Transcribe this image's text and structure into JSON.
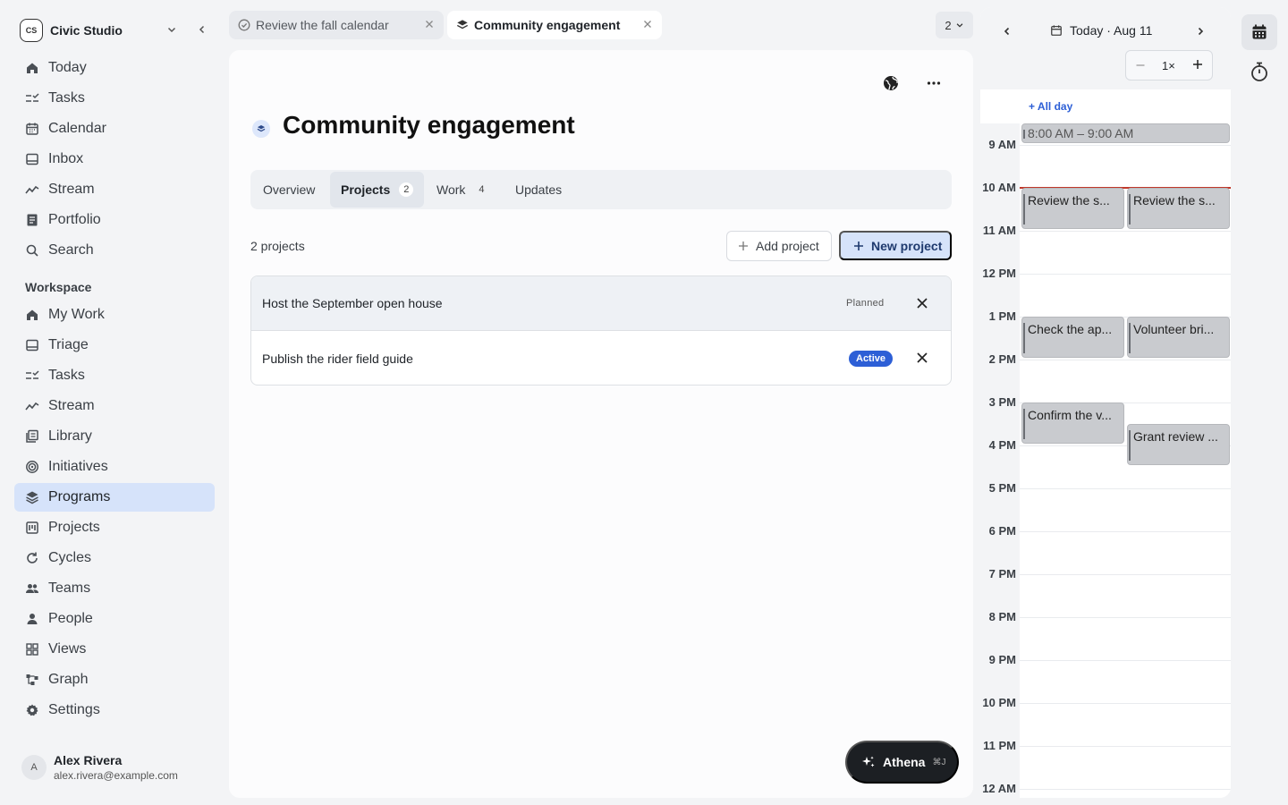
{
  "workspace": {
    "logo": "CS",
    "name": "Civic Studio"
  },
  "nav_main": [
    {
      "label": "Today",
      "icon": "home-icon"
    },
    {
      "label": "Tasks",
      "icon": "tasks-icon"
    },
    {
      "label": "Calendar",
      "icon": "calendar-icon"
    },
    {
      "label": "Inbox",
      "icon": "inbox-icon"
    },
    {
      "label": "Stream",
      "icon": "stream-icon"
    },
    {
      "label": "Portfolio",
      "icon": "portfolio-icon"
    },
    {
      "label": "Search",
      "icon": "search-icon"
    }
  ],
  "workspace_section": {
    "label": "Workspace",
    "items": [
      {
        "label": "My Work",
        "icon": "home-icon"
      },
      {
        "label": "Triage",
        "icon": "inbox-icon"
      },
      {
        "label": "Tasks",
        "icon": "tasks-icon"
      },
      {
        "label": "Stream",
        "icon": "stream-icon"
      },
      {
        "label": "Library",
        "icon": "library-icon"
      },
      {
        "label": "Initiatives",
        "icon": "target-icon"
      },
      {
        "label": "Programs",
        "icon": "layers-icon",
        "active": true
      },
      {
        "label": "Projects",
        "icon": "projects-icon"
      },
      {
        "label": "Cycles",
        "icon": "cycle-icon"
      },
      {
        "label": "Teams",
        "icon": "teams-icon"
      },
      {
        "label": "People",
        "icon": "person-icon"
      },
      {
        "label": "Views",
        "icon": "views-icon"
      },
      {
        "label": "Graph",
        "icon": "graph-icon"
      },
      {
        "label": "Settings",
        "icon": "gear-icon"
      }
    ]
  },
  "user": {
    "initial": "A",
    "name": "Alex Rivera",
    "email": "alex.rivera@example.com"
  },
  "tabs": [
    {
      "label": "Review the fall calendar",
      "icon": "check-circle-icon"
    },
    {
      "label": "Community engagement",
      "icon": "layers-icon",
      "active": true
    }
  ],
  "tab_count": "2",
  "page": {
    "title": "Community engagement",
    "segments": [
      {
        "label": "Overview",
        "count": ""
      },
      {
        "label": "Projects",
        "count": "2",
        "active": true
      },
      {
        "label": "Work",
        "count": "4"
      },
      {
        "label": "Updates",
        "count": ""
      }
    ],
    "project_count": "2 projects",
    "add_project": "Add project",
    "new_project": "New project",
    "projects": [
      {
        "name": "Host the September open house",
        "status": "Planned"
      },
      {
        "name": "Publish the rider field guide",
        "status": "Active"
      }
    ]
  },
  "athena": {
    "label": "Athena",
    "shortcut": "⌘J"
  },
  "calendar": {
    "date_label": "Today · Aug 11",
    "zoom": "1×",
    "all_day": "+ All day",
    "hours": [
      "9 AM",
      "10 AM",
      "11 AM",
      "12 PM",
      "1 PM",
      "2 PM",
      "3 PM",
      "4 PM",
      "5 PM",
      "6 PM",
      "7 PM",
      "8 PM",
      "9 PM",
      "10 PM",
      "11 PM",
      "12 AM"
    ],
    "events": [
      {
        "title": "8:00 AM – 9:00 AM"
      },
      {
        "title": "Review the s..."
      },
      {
        "title": "Review the s..."
      },
      {
        "title": "Check the ap..."
      },
      {
        "title": "Volunteer bri..."
      },
      {
        "title": "Confirm the v..."
      },
      {
        "title": "Grant review ..."
      }
    ]
  },
  "colors": {
    "accent": "#2d5fd6",
    "active_nav": "#d6e3fa",
    "now_line": "#c0392b",
    "event": "#c9cbcf"
  }
}
